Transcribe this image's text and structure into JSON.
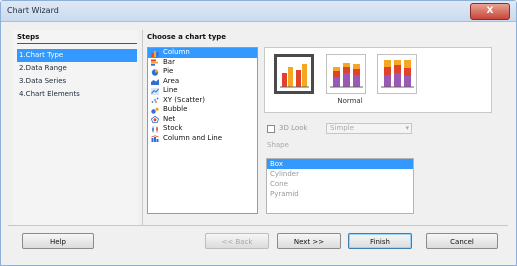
{
  "window": {
    "title": "Chart Wizard",
    "close_label": "X"
  },
  "steps": {
    "title": "Steps",
    "items": [
      "1.Chart Type",
      "2.Data Range",
      "3.Data Series",
      "4.Chart Elements"
    ]
  },
  "chart_types": {
    "title": "Choose a chart type",
    "items": [
      {
        "label": "Column",
        "icon": "column-chart-icon"
      },
      {
        "label": "Bar",
        "icon": "bar-chart-icon"
      },
      {
        "label": "Pie",
        "icon": "pie-chart-icon"
      },
      {
        "label": "Area",
        "icon": "area-chart-icon"
      },
      {
        "label": "Line",
        "icon": "line-chart-icon"
      },
      {
        "label": "XY (Scatter)",
        "icon": "scatter-chart-icon"
      },
      {
        "label": "Bubble",
        "icon": "bubble-chart-icon"
      },
      {
        "label": "Net",
        "icon": "net-chart-icon"
      },
      {
        "label": "Stock",
        "icon": "stock-chart-icon"
      },
      {
        "label": "Column and Line",
        "icon": "column-line-chart-icon"
      }
    ]
  },
  "variant": {
    "label": "Normal"
  },
  "look_3d": {
    "label": "3D Look",
    "select_value": "Simple"
  },
  "shape": {
    "label": "Shape",
    "items": [
      "Box",
      "Cylinder",
      "Cone",
      "Pyramid"
    ]
  },
  "buttons": {
    "help": "Help",
    "back": "<< Back",
    "next": "Next >>",
    "finish": "Finish",
    "cancel": "Cancel"
  },
  "colors": {
    "selection": "#3399ff",
    "bar_red": "#e0432a",
    "bar_orange": "#f5a623",
    "bar_purple": "#9b59b6"
  }
}
